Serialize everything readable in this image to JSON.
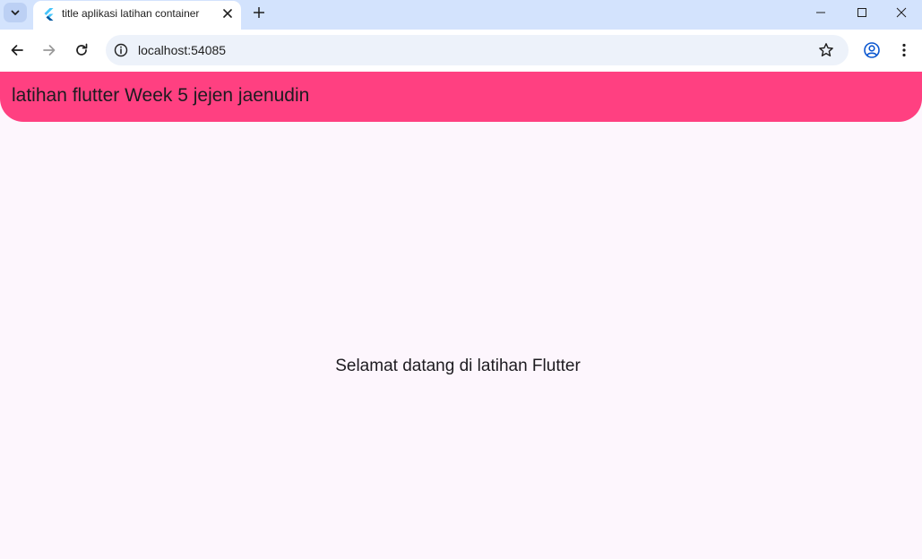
{
  "browser": {
    "tab_title": "title aplikasi latihan container",
    "url": "localhost:54085",
    "icons": [
      "tab-search-icon",
      "flutter-icon",
      "close-icon",
      "plus-icon",
      "minimize-icon",
      "maximize-icon",
      "window-close-icon",
      "back-icon",
      "forward-icon",
      "reload-icon",
      "info-icon",
      "star-icon",
      "profile-icon",
      "more-icon"
    ]
  },
  "app": {
    "appbar_title": "latihan flutter Week 5 jejen jaenudin",
    "body_text": "Selamat datang di latihan Flutter",
    "colors": {
      "appbar": "#ff4081",
      "background": "#fdf6fd",
      "text": "#1d1b20"
    }
  }
}
